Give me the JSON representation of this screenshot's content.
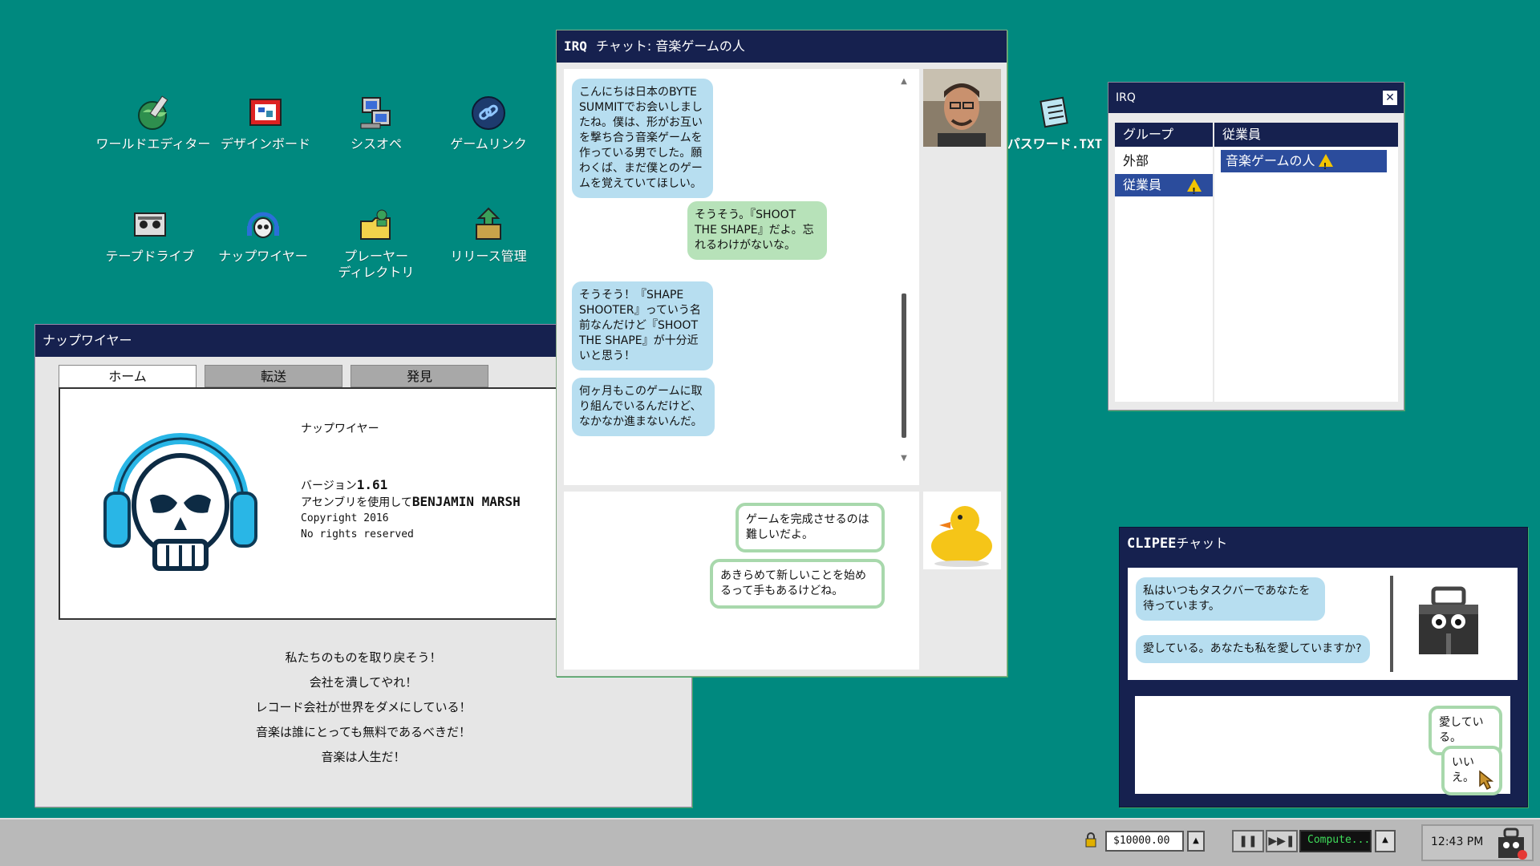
{
  "desktop_icons": [
    {
      "label": "ワールドエディター",
      "icon": "globe-brush-icon"
    },
    {
      "label": "デザインボード",
      "icon": "design-board-icon"
    },
    {
      "label": "シスオペ",
      "icon": "computer-icon"
    },
    {
      "label": "ゲームリンク",
      "icon": "link-icon"
    },
    {
      "label": "テープドライブ",
      "icon": "tape-drive-icon"
    },
    {
      "label": "ナップワイヤー",
      "icon": "skull-headphones-icon"
    },
    {
      "label": "プレーヤー\nディレクトリ",
      "icon": "folder-user-icon"
    },
    {
      "label": "リリース管理",
      "icon": "release-box-icon"
    },
    {
      "label": "パスワード.TXT",
      "icon": "notepad-icon"
    }
  ],
  "napwire": {
    "title": "ナップワイヤー",
    "tabs": [
      "ホーム",
      "転送",
      "発見"
    ],
    "app_name": "ナップワイヤー",
    "version_label": "バージョン",
    "version": "1.61",
    "author_prefix": "アセンブリを使用して",
    "author": "BENJAMIN MARSH",
    "copyright": "Copyright 2016",
    "rights": "No rights reserved",
    "slogans": [
      "私たちのものを取り戻そう！",
      "会社を潰してやれ！",
      "レコード会社が世界をダメにしている！",
      "音楽は誰にとっても無料であるべきだ！",
      "音楽は人生だ！"
    ]
  },
  "irq_chat": {
    "title_prefix": "IRQ",
    "title": "チャット: 音楽ゲームの人",
    "messages": [
      {
        "from": "them",
        "text": "こんにちは日本のBYTE SUMMITでお会いしましたね。僕は、形がお互いを撃ち合う音楽ゲームを作っている男でした。願わくば、まだ僕とのゲームを覚えていてほしい。"
      },
      {
        "from": "me",
        "text": "そうそう。『SHOOT THE SHAPE』だよ。忘れるわけがないな。"
      },
      {
        "from": "them",
        "text": "そうそう！『SHAPE SHOOTER』っていう名前なんだけど『SHOOT THE SHAPE』が十分近いと思う！"
      },
      {
        "from": "them",
        "text": "何ヶ月もこのゲームに取り組んでいるんだけど、なかなか進まないんだ。"
      }
    ],
    "replies": [
      "ゲームを完成させるのは難しいだよ。",
      "あきらめて新しいことを始めるって手もあるけどね。"
    ]
  },
  "irq_group": {
    "title": "IRQ",
    "group_header": "グループ",
    "member_header": "従業員",
    "groups": [
      "外部",
      "従業員"
    ],
    "members": [
      "音楽ゲームの人"
    ]
  },
  "clipee": {
    "title_prefix": "CLIPEE",
    "title": "チャット",
    "messages": [
      "私はいつもタスクバーであなたを待っています。",
      "愛している。あなたも私を愛していますか?"
    ],
    "replies": [
      "愛している。",
      "いいえ。"
    ]
  },
  "taskbar": {
    "money": "$10000.00",
    "status": "Compute...",
    "clock": "12:43 PM"
  },
  "colors": {
    "desktop": "#00897f",
    "titlebar": "#16214f",
    "bubble_blue": "#b7def0",
    "bubble_green": "#b7e2b9"
  }
}
